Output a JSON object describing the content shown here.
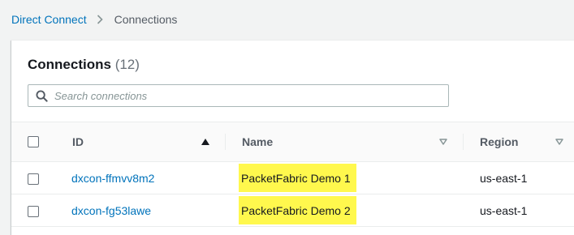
{
  "breadcrumb": {
    "parent": "Direct Connect",
    "current": "Connections"
  },
  "panel": {
    "title": "Connections",
    "count": "(12)"
  },
  "search": {
    "placeholder": "Search connections",
    "value": ""
  },
  "table": {
    "headers": {
      "id": "ID",
      "name": "Name",
      "region": "Region"
    },
    "sort": {
      "column": "id",
      "direction": "ascending"
    },
    "rows": [
      {
        "id": "dxcon-ffmvv8m2",
        "name": "PacketFabric Demo 1",
        "region": "us-east-1",
        "highlighted": true
      },
      {
        "id": "dxcon-fg53lawe",
        "name": "PacketFabric Demo 2",
        "region": "us-east-1",
        "highlighted": true
      }
    ]
  },
  "colors": {
    "link": "#0073bb",
    "highlight": "#fff84d",
    "background": "#f2f3f3"
  }
}
